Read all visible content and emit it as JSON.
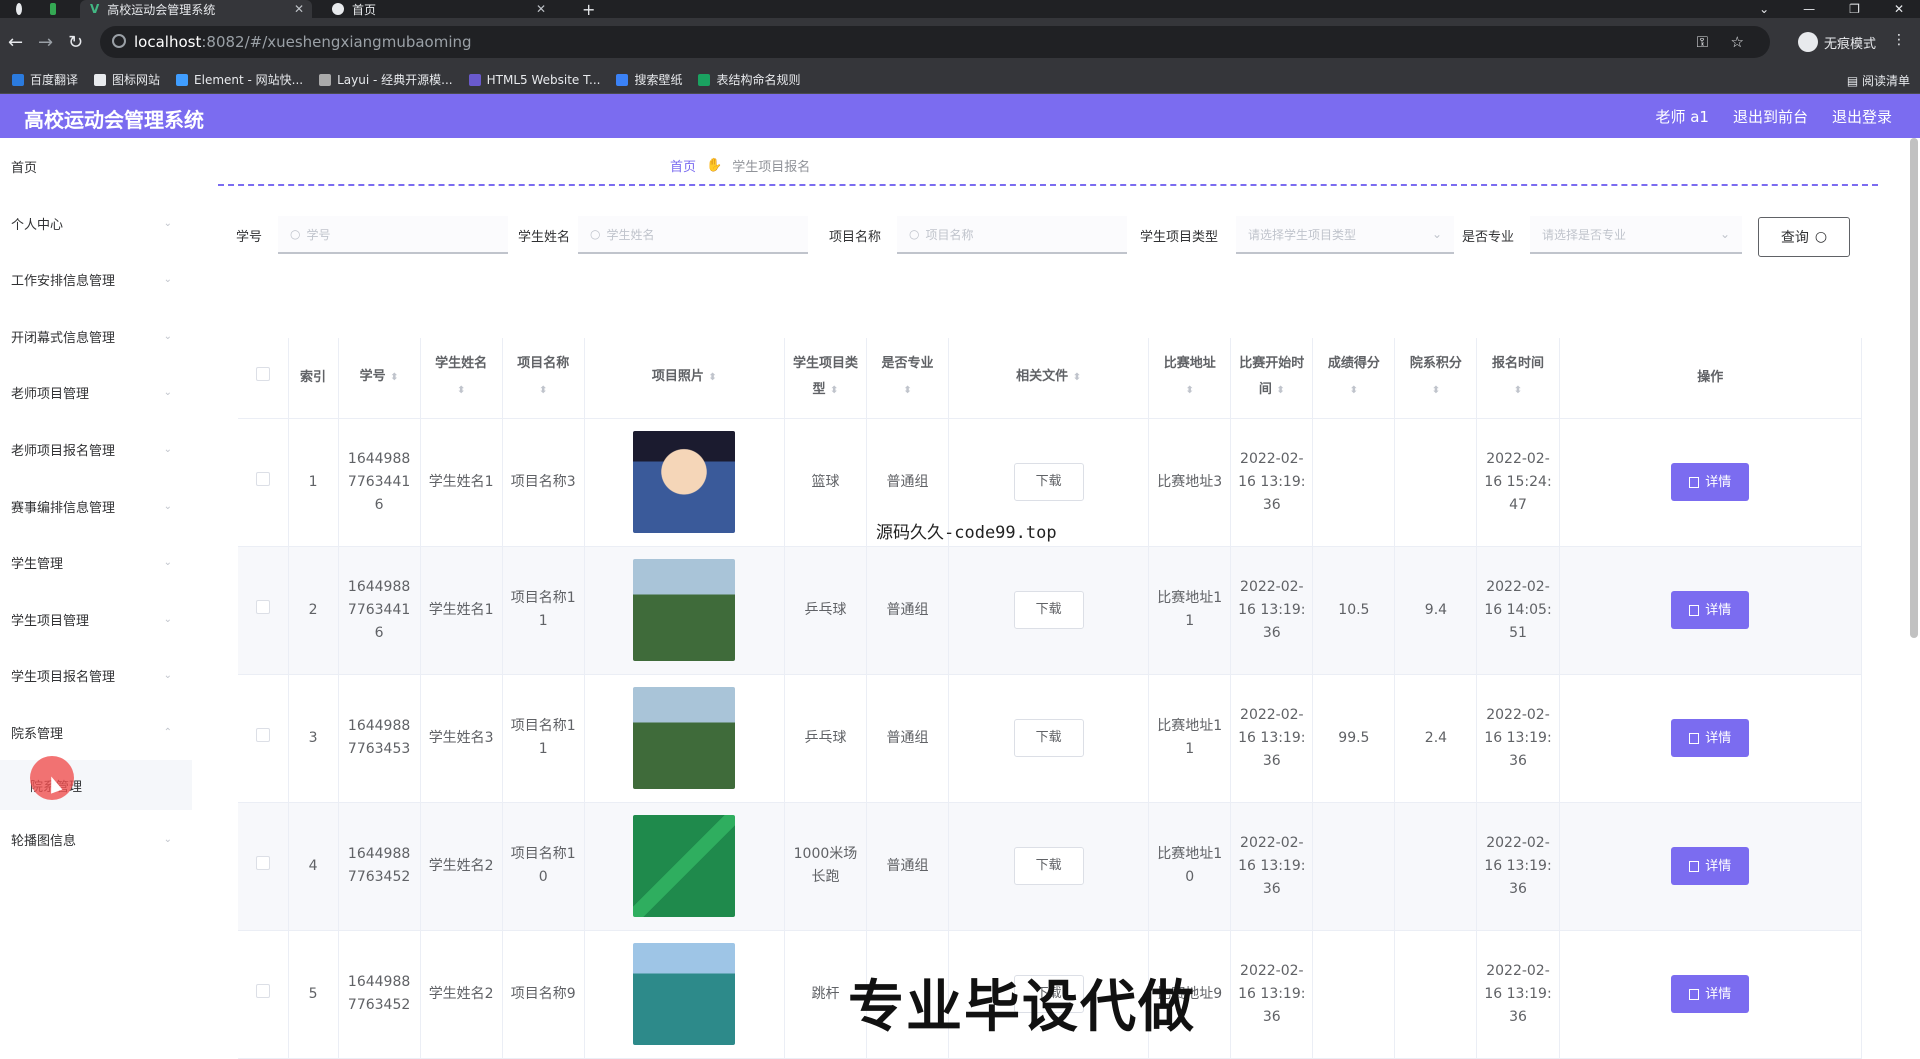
{
  "browser": {
    "tabs": [
      {
        "title": "高校运动会管理系统",
        "active": true
      },
      {
        "title": "首页",
        "active": false
      }
    ],
    "url_host": "localhost",
    "url_path": ":8082/#/xueshengxiangmubaoming",
    "profile": "无痕模式",
    "bookmarks": [
      "百度翻译",
      "图标网站",
      "Element - 网站快...",
      "Layui - 经典开源模...",
      "HTML5 Website T...",
      "搜索壁纸",
      "表结构命名规则"
    ],
    "reading_list": "阅读清单"
  },
  "header": {
    "title": "高校运动会管理系统",
    "user": "老师 a1",
    "back_front": "退出到前台",
    "logout": "退出登录"
  },
  "sidebar": {
    "items": [
      {
        "label": "首页"
      },
      {
        "label": "个人中心"
      },
      {
        "label": "工作安排信息管理"
      },
      {
        "label": "开闭幕式信息管理"
      },
      {
        "label": "老师项目管理"
      },
      {
        "label": "老师项目报名管理"
      },
      {
        "label": "赛事编排信息管理"
      },
      {
        "label": "学生管理"
      },
      {
        "label": "学生项目管理"
      },
      {
        "label": "学生项目报名管理"
      },
      {
        "label": "院系管理"
      },
      {
        "label": "院系管理"
      },
      {
        "label": "轮播图信息"
      }
    ]
  },
  "breadcrumb": {
    "home": "首页",
    "current": "学生项目报名"
  },
  "filters": {
    "student_no_label": "学号",
    "student_no_placeholder": "学号",
    "student_name_label": "学生姓名",
    "student_name_placeholder": "学生姓名",
    "project_name_label": "项目名称",
    "project_name_placeholder": "项目名称",
    "project_type_label": "学生项目类型",
    "project_type_placeholder": "请选择学生项目类型",
    "professional_label": "是否专业",
    "professional_placeholder": "请选择是否专业",
    "query_button": "查询"
  },
  "table": {
    "headers": [
      "索引",
      "学号",
      "学生姓名",
      "项目名称",
      "项目照片",
      "学生项目类型",
      "是否专业",
      "相关文件",
      "比赛地址",
      "比赛开始时间",
      "成绩得分",
      "院系积分",
      "报名时间",
      "操作"
    ],
    "download_label": "下载",
    "detail_label": "详情",
    "rows": [
      {
        "index": "1",
        "student_no": "16449887763441 6",
        "name": "学生姓名1",
        "project": "项目名称3",
        "photo": "cartoon-character",
        "type": "篮球",
        "professional": "普通组",
        "address": "比赛地址3",
        "start": "2022-02-16 13:19:36",
        "score": "",
        "dept_points": "",
        "signup": "2022-02-16 15:24:47"
      },
      {
        "index": "2",
        "student_no": "16449887763441 6",
        "name": "学生姓名1",
        "project": "项目名称11",
        "photo": "football-pitch",
        "type": "乒乓球",
        "professional": "普通组",
        "address": "比赛地址11",
        "start": "2022-02-16 13:19:36",
        "score": "10.5",
        "dept_points": "9.4",
        "signup": "2022-02-16 14:05:51"
      },
      {
        "index": "3",
        "student_no": "16449887763453",
        "name": "学生姓名3",
        "project": "项目名称11",
        "photo": "football-pitch",
        "type": "乒乓球",
        "professional": "普通组",
        "address": "比赛地址11",
        "start": "2022-02-16 13:19:36",
        "score": "99.5",
        "dept_points": "2.4",
        "signup": "2022-02-16 13:19:36"
      },
      {
        "index": "4",
        "student_no": "16449887763452",
        "name": "学生姓名2",
        "project": "项目名称10",
        "photo": "badminton-court",
        "type": "1000米场长跑",
        "professional": "普通组",
        "address": "比赛地址10",
        "start": "2022-02-16 13:19:36",
        "score": "",
        "dept_points": "",
        "signup": "2022-02-16 13:19:36"
      },
      {
        "index": "5",
        "student_no": "16449887763452",
        "name": "学生姓名2",
        "project": "项目名称9",
        "photo": "tennis-court",
        "type": "跳杆",
        "professional": "",
        "address": "比赛地址9",
        "start": "2022-02-16 13:19:36",
        "score": "",
        "dept_points": "",
        "signup": "2022-02-16 13:19:36"
      }
    ]
  },
  "overlays": {
    "site": "源码久久-code99.top",
    "banner": "专业毕设代做"
  },
  "colors": {
    "accent": "#7b6cf0"
  }
}
